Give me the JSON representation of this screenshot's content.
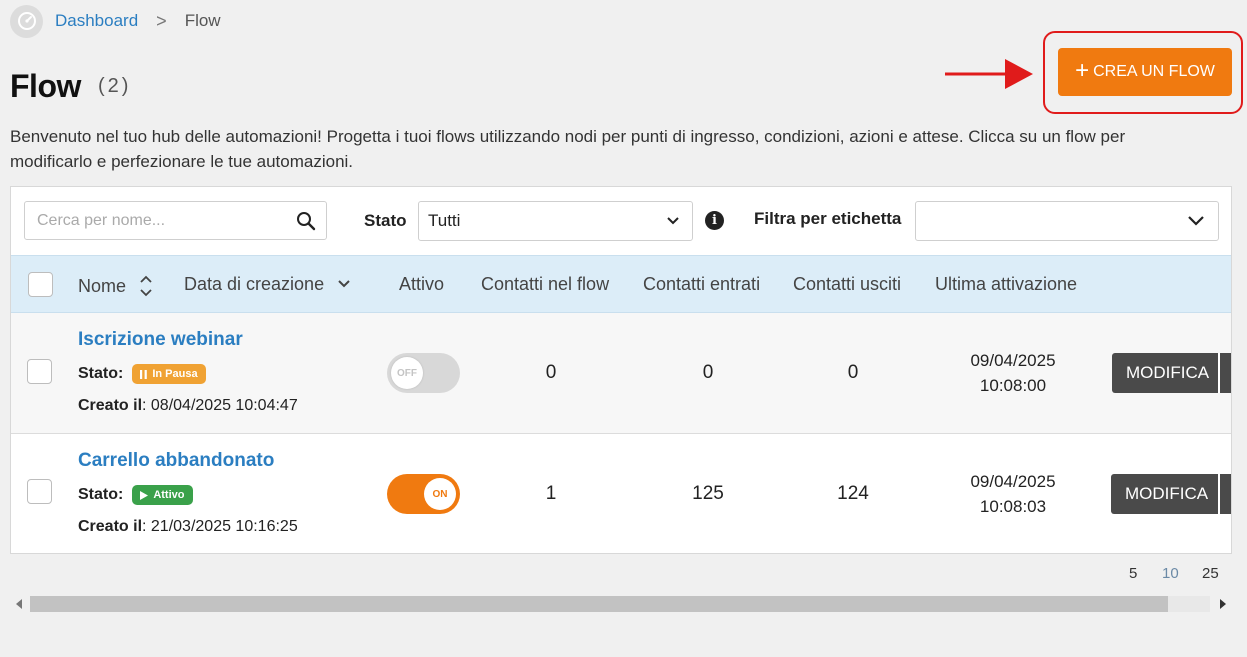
{
  "breadcrumb": {
    "home": "Dashboard",
    "separator": ">",
    "current": "Flow"
  },
  "header": {
    "title": "Flow",
    "count": "(2)",
    "create_label": "CREA UN FLOW",
    "create_plus": "+"
  },
  "intro": "Benvenuto nel tuo hub delle automazioni! Progetta i tuoi flows utilizzando nodi per punti di ingresso, condizioni, azioni e attese. Clicca su un flow per modificarlo e perfezionare le tue automazioni.",
  "filters": {
    "search_placeholder": "Cerca per nome...",
    "stato_label": "Stato",
    "stato_value": "Tutti",
    "info_glyph": "i",
    "tag_label": "Filtra per etichetta",
    "tag_value": ""
  },
  "columns": {
    "name": "Nome",
    "created": "Data di creazione",
    "active": "Attivo",
    "in_flow": "Contatti nel flow",
    "entered": "Contatti entrati",
    "exited": "Contatti usciti",
    "last_activation": "Ultima attivazione"
  },
  "rows": [
    {
      "name": "Iscrizione webinar",
      "status_label": "Stato:",
      "status_badge": "In Pausa",
      "created_label": "Creato il",
      "created_value": ": 08/04/2025 10:04:47",
      "toggle": "OFF",
      "in_flow": "0",
      "entered": "0",
      "exited": "0",
      "last_date": "09/04/2025",
      "last_time": "10:08:00",
      "edit_label": "MODIFICA"
    },
    {
      "name": "Carrello abbandonato",
      "status_label": "Stato:",
      "status_badge": "Attivo",
      "created_label": "Creato il",
      "created_value": ": 21/03/2025 10:16:25",
      "toggle": "ON",
      "in_flow": "1",
      "entered": "125",
      "exited": "124",
      "last_date": "09/04/2025",
      "last_time": "10:08:03",
      "edit_label": "MODIFICA"
    }
  ],
  "pagination": {
    "sizes": [
      "5",
      "10",
      "25"
    ],
    "selected": "10"
  },
  "colors": {
    "accent": "#f07a10",
    "link": "#2b7ec1",
    "header_bg": "#dcedf8",
    "paused": "#f0a233",
    "active": "#3aa14a",
    "annotation": "#e01b1b"
  },
  "icons": {
    "home": "dashboard-gauge-icon",
    "search": "search-icon",
    "dropdown": "chevron-down-icon",
    "sort": "sort-icon",
    "annotation": "arrow-right-icon"
  }
}
